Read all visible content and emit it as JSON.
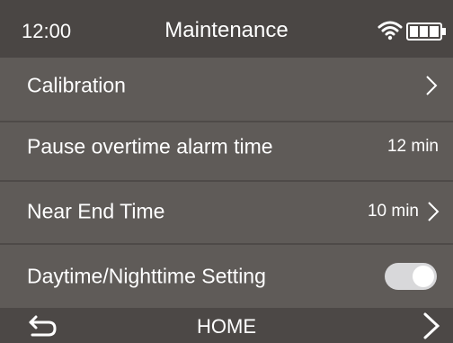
{
  "status_bar": {
    "time": "12:00",
    "title": "Maintenance",
    "icons": [
      "wifi-icon",
      "battery-icon"
    ]
  },
  "menu": {
    "items": [
      {
        "label": "Calibration",
        "value": "",
        "control": "chevron-right-icon"
      },
      {
        "label": "Pause overtime alarm time",
        "value": "12 min",
        "control": ""
      },
      {
        "label": "Near End Time",
        "value": "10 min",
        "control": "chevron-right-icon"
      },
      {
        "label": "Daytime/Nighttime Setting",
        "value": "",
        "control": "toggle",
        "toggle_on": true
      }
    ]
  },
  "bottom_bar": {
    "back_icon": "return-icon",
    "home_label": "HOME",
    "next_icon": "chevron-right-icon"
  },
  "colors": {
    "background": "#5f5b58",
    "bar_background": "#4a4644",
    "text": "#ffffff",
    "toggle_on": "#d8d8da"
  }
}
